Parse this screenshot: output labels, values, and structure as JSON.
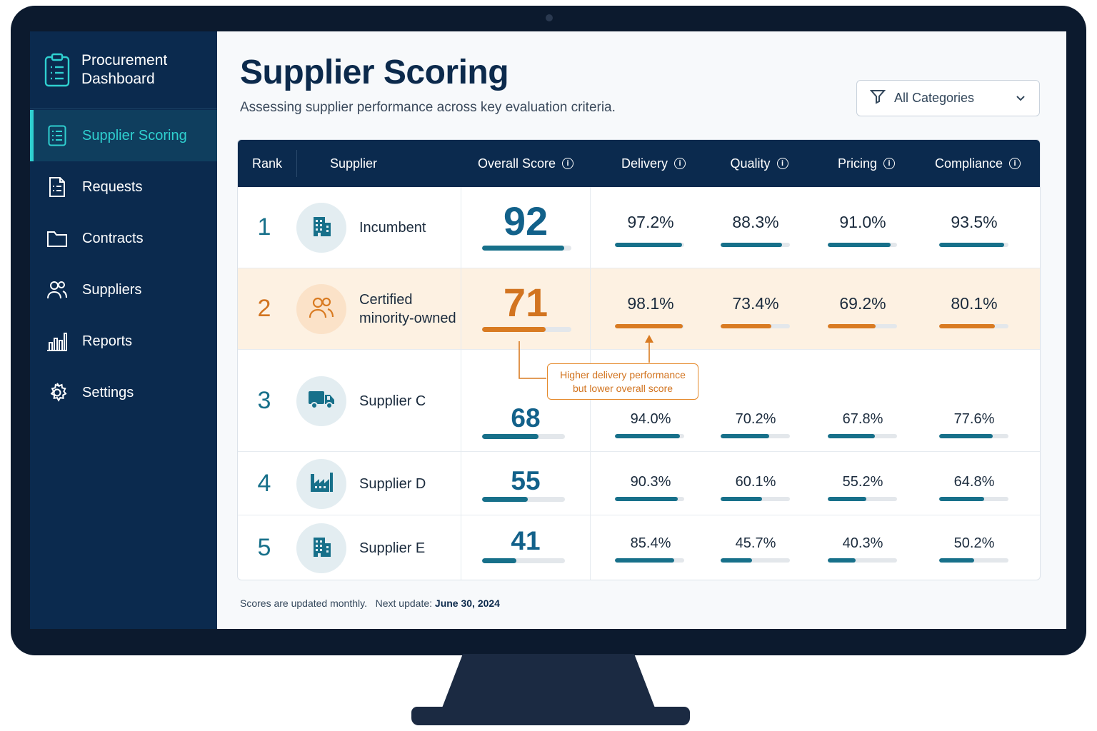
{
  "app": {
    "title": "Procurement Dashboard"
  },
  "sidebar": {
    "items": [
      {
        "label": "Supplier Scoring",
        "icon": "list-icon",
        "active": true
      },
      {
        "label": "Requests",
        "icon": "document-icon"
      },
      {
        "label": "Contracts",
        "icon": "folder-icon"
      },
      {
        "label": "Suppliers",
        "icon": "users-icon"
      },
      {
        "label": "Reports",
        "icon": "bar-chart-icon"
      },
      {
        "label": "Settings",
        "icon": "gear-icon"
      }
    ]
  },
  "header": {
    "title": "Supplier Scoring",
    "subtitle": "Assessing supplier performance across key evaluation criteria.",
    "filter_label": "All Categories"
  },
  "table": {
    "columns": {
      "rank": "Rank",
      "supplier": "Supplier",
      "overall": "Overall Score",
      "delivery": "Delivery",
      "quality": "Quality",
      "pricing": "Pricing",
      "compliance": "Compliance"
    },
    "rows": [
      {
        "rank": "1",
        "name": "Incumbent",
        "icon": "building-icon",
        "overall": "92",
        "overall_value": 92,
        "delivery": "97.2%",
        "delivery_value": 97.2,
        "quality": "88.3%",
        "quality_value": 88.3,
        "pricing": "91.0%",
        "pricing_value": 91.0,
        "compliance": "93.5%",
        "compliance_value": 93.5
      },
      {
        "rank": "2",
        "name": "Certified minority-owned",
        "icon": "users-icon",
        "highlighted": true,
        "overall": "71",
        "overall_value": 71,
        "delivery": "98.1%",
        "delivery_value": 98.1,
        "quality": "73.4%",
        "quality_value": 73.4,
        "pricing": "69.2%",
        "pricing_value": 69.2,
        "compliance": "80.1%",
        "compliance_value": 80.1
      },
      {
        "rank": "3",
        "name": "Supplier C",
        "icon": "truck-icon",
        "overall": "68",
        "overall_value": 68,
        "delivery": "94.0%",
        "delivery_value": 94.0,
        "quality": "70.2%",
        "quality_value": 70.2,
        "pricing": "67.8%",
        "pricing_value": 67.8,
        "compliance": "77.6%",
        "compliance_value": 77.6
      },
      {
        "rank": "4",
        "name": "Supplier D",
        "icon": "factory-icon",
        "overall": "55",
        "overall_value": 55,
        "delivery": "90.3%",
        "delivery_value": 90.3,
        "quality": "60.1%",
        "quality_value": 60.1,
        "pricing": "55.2%",
        "pricing_value": 55.2,
        "compliance": "64.8%",
        "compliance_value": 64.8
      },
      {
        "rank": "5",
        "name": "Supplier E",
        "icon": "building-icon",
        "overall": "41",
        "overall_value": 41,
        "delivery": "85.4%",
        "delivery_value": 85.4,
        "quality": "45.7%",
        "quality_value": 45.7,
        "pricing": "40.3%",
        "pricing_value": 40.3,
        "compliance": "50.2%",
        "compliance_value": 50.2
      }
    ]
  },
  "callout": {
    "line1": "Higher delivery performance",
    "line2": "but lower overall score"
  },
  "footer": {
    "note": "Scores are updated monthly.",
    "next_label": "Next update:",
    "next_date": "June 30, 2024"
  },
  "colors": {
    "navy": "#0b2a4e",
    "teal": "#17708a",
    "accent_cyan": "#2fd0d0",
    "orange": "#d27420",
    "highlight_bg": "#fdf1e2"
  }
}
